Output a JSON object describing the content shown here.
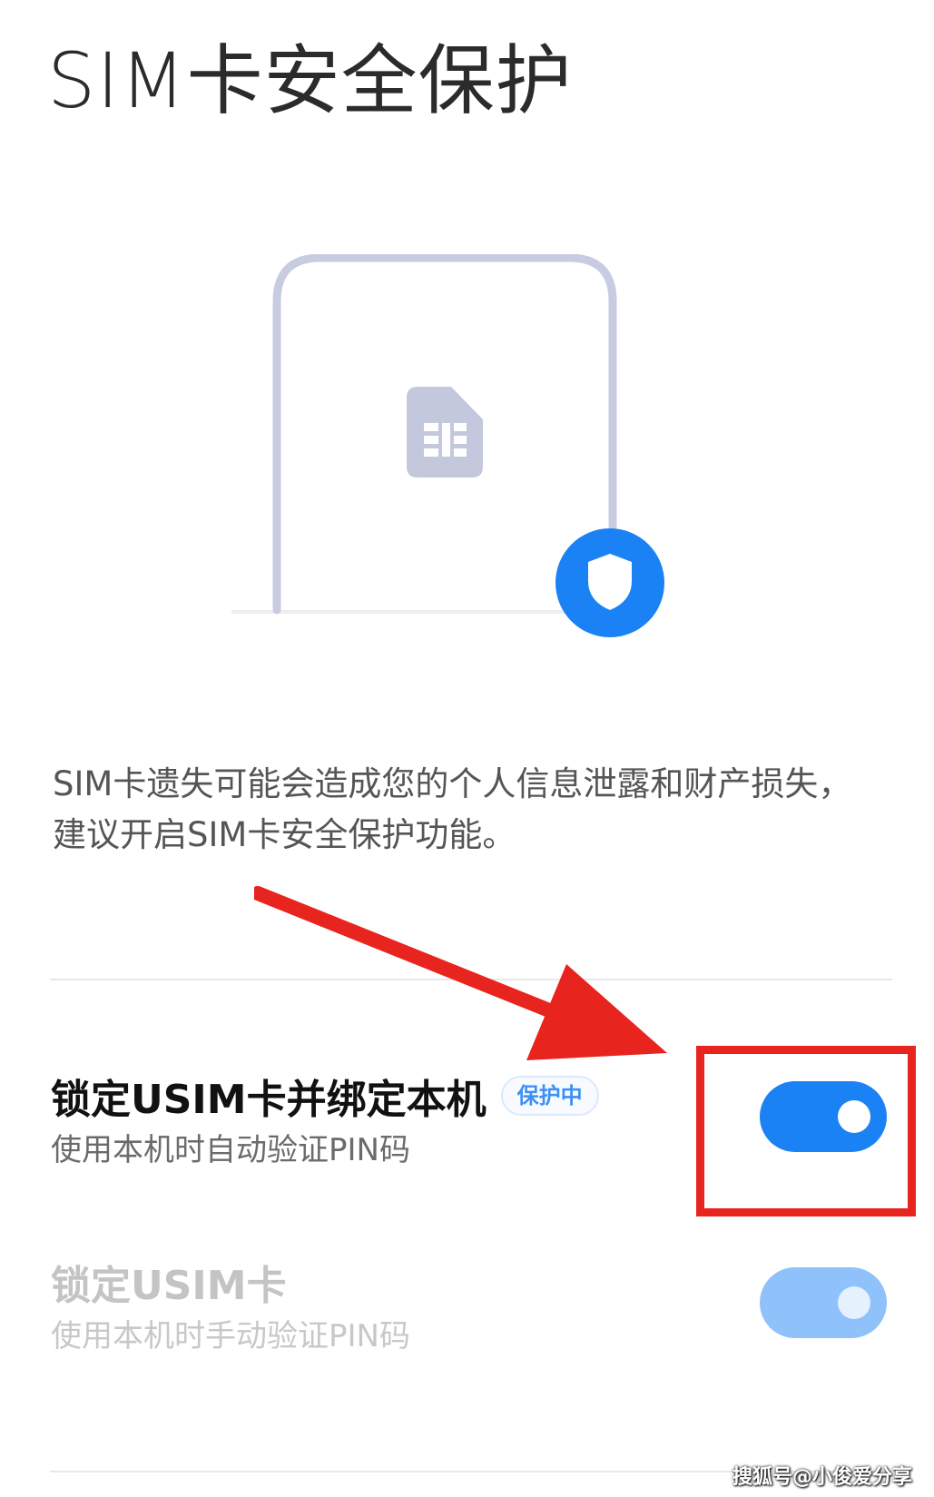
{
  "page": {
    "title": "SIM卡安全保护"
  },
  "illustration": {
    "icons": [
      "sim-card-icon",
      "shield-icon"
    ],
    "colors": {
      "outline": "#c8cce0",
      "sim_card": "#c4c8dc",
      "shield_circle": "#1a82f5"
    }
  },
  "description": "SIM卡遗失可能会造成您的个人信息泄露和财产损失，建议开启SIM卡安全保护功能。",
  "settings": [
    {
      "title": "锁定USIM卡并绑定本机",
      "badge": "保护中",
      "subtitle": "使用本机时自动验证PIN码",
      "enabled": true,
      "toggle_on": true
    },
    {
      "title": "锁定USIM卡",
      "subtitle": "使用本机时手动验证PIN码",
      "enabled": false,
      "toggle_on": true
    }
  ],
  "annotation": {
    "highlight_color": "#e8241f",
    "icons": [
      "red-arrow-icon"
    ]
  },
  "watermark": "搜狐号@小俊爱分享",
  "colors": {
    "accent": "#1a82f5",
    "accent_disabled": "#8fc1fb",
    "badge_text": "#3d8ff5"
  }
}
